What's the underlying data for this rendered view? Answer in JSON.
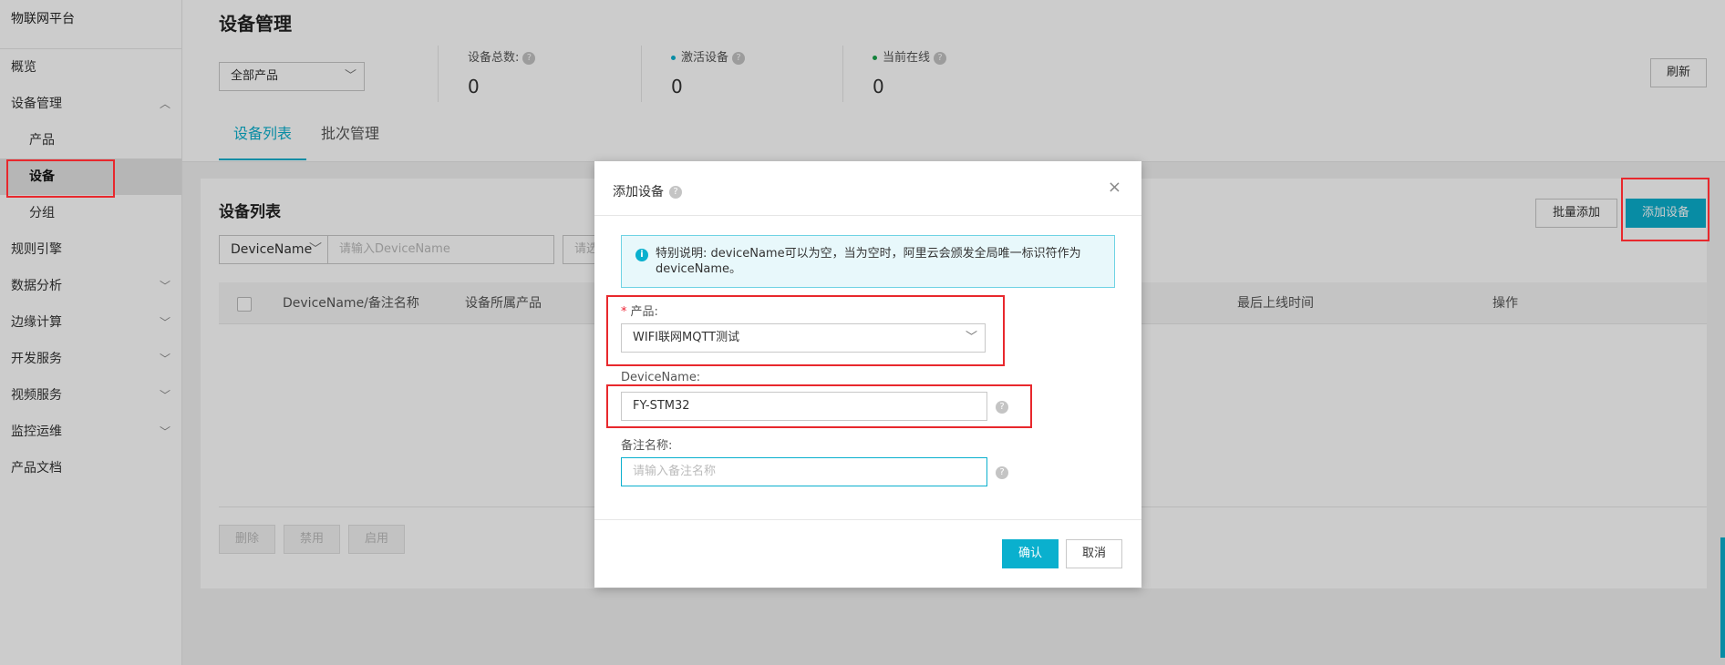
{
  "sidebar": {
    "title": "物联网平台",
    "items": [
      {
        "label": "概览"
      },
      {
        "label": "设备管理",
        "chevron": "chevron-up-icon"
      },
      {
        "label": "产品"
      },
      {
        "label": "设备"
      },
      {
        "label": "分组"
      },
      {
        "label": "规则引擎"
      },
      {
        "label": "数据分析",
        "chevron": "chevron-down-icon"
      },
      {
        "label": "边缘计算",
        "chevron": "chevron-down-icon"
      },
      {
        "label": "开发服务",
        "chevron": "chevron-down-icon"
      },
      {
        "label": "视频服务",
        "chevron": "chevron-down-icon"
      },
      {
        "label": "监控运维",
        "chevron": "chevron-down-icon"
      },
      {
        "label": "产品文档"
      }
    ]
  },
  "header": {
    "title": "设备管理",
    "product_select": "全部产品",
    "stats": [
      {
        "label": "设备总数:",
        "value": "0"
      },
      {
        "label": "激活设备",
        "value": "0",
        "dot_color": "#0ab0ce"
      },
      {
        "label": "当前在线",
        "value": "0",
        "dot_color": "#1aa34a"
      }
    ],
    "refresh": "刷新",
    "tabs": [
      "设备列表",
      "批次管理"
    ]
  },
  "panel": {
    "title": "设备列表",
    "batch_add": "批量添加",
    "add_device": "添加设备",
    "filter_field": "DeviceName",
    "filter_placeholder": "请输入DeviceName",
    "filter_placeholder2": "请选",
    "columns": [
      "DeviceName/备注名称",
      "设备所属产品",
      "最后上线时间",
      "操作"
    ],
    "footer_buttons": [
      "删除",
      "禁用",
      "启用"
    ]
  },
  "modal": {
    "title": "添加设备",
    "close": "×",
    "info": "特别说明: deviceName可以为空，当为空时，阿里云会颁发全局唯一标识符作为deviceName。",
    "product_label": "产品:",
    "product_required": "*",
    "product_value": "WIFI联网MQTT测试",
    "devicename_label": "DeviceName:",
    "devicename_value": "FY-STM32",
    "remark_label": "备注名称:",
    "remark_placeholder": "请输入备注名称",
    "confirm": "确认",
    "cancel": "取消"
  },
  "colors": {
    "accent": "#0ab0ce",
    "annotation": "#e8282d"
  }
}
